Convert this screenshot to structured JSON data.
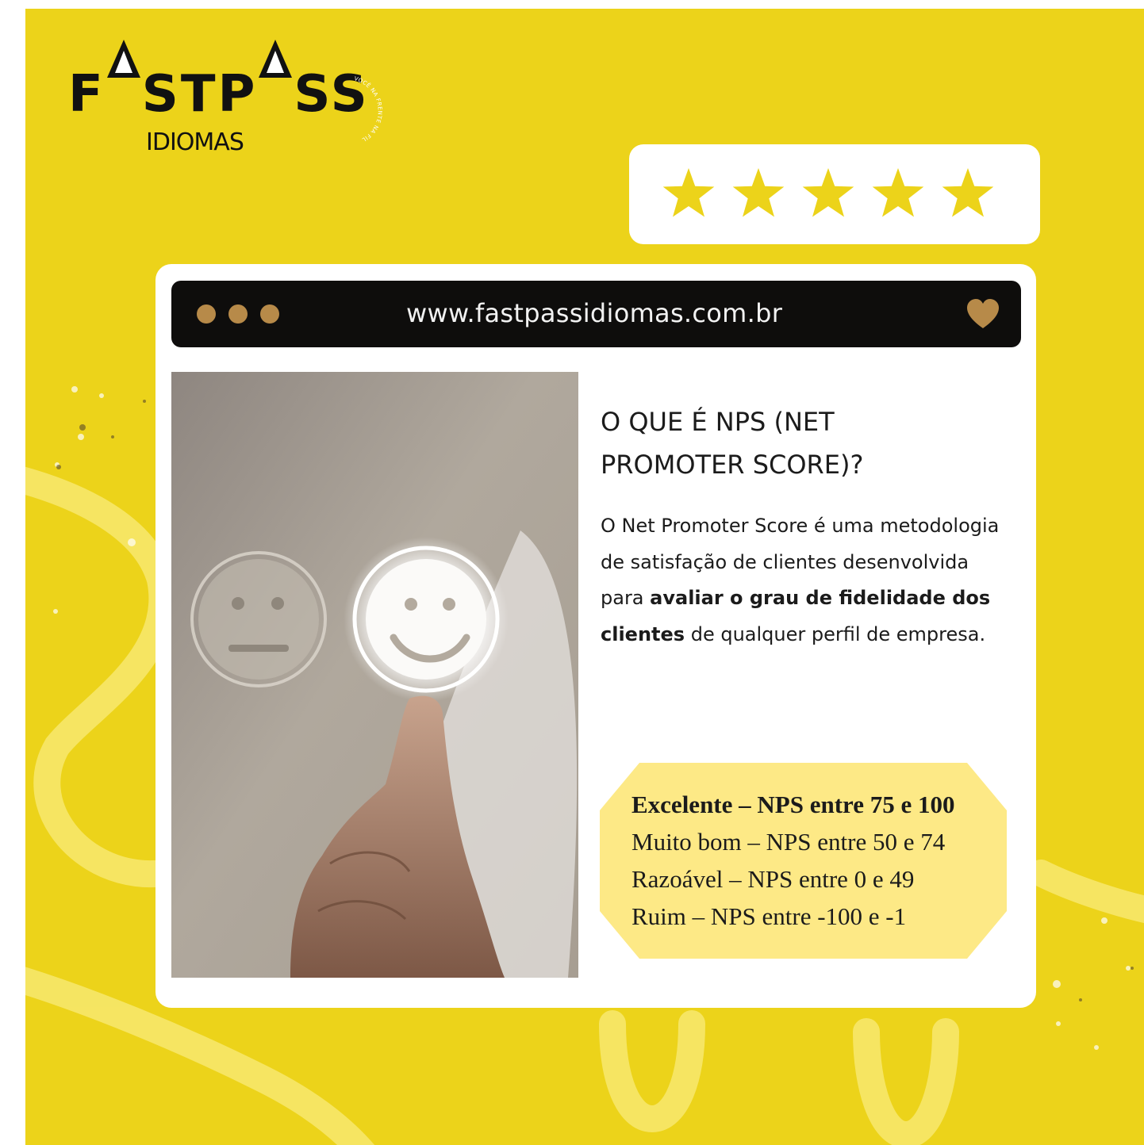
{
  "brand": {
    "name_part1": "F",
    "name_part2": "STP",
    "name_part3": "SS",
    "subtitle": "IDIOMAS",
    "seal_text": "VOCÊ NA FRENTE NA FILA PARA O SUCESSO"
  },
  "rating": {
    "stars": 5,
    "max": 5,
    "star_color": "#ecd31a"
  },
  "browser": {
    "url": "www.fastpassidiomas.com.br",
    "dot_color": "#b78a49"
  },
  "article": {
    "title_line1": "O QUE É NPS (NET",
    "title_line2": "PROMOTER SCORE)?",
    "body_intro": "O Net Promoter Score é uma metodologia de satisfação de clientes desenvolvida para ",
    "body_bold": "avaliar o grau de fidelidade dos clientes",
    "body_end": " de qualquer perfil de empresa."
  },
  "nps": {
    "lines": [
      "Excelente – NPS entre 75 e 100",
      "Muito bom – NPS entre 50 e 74",
      "Razoável – NPS entre 0 e 49",
      "Ruim – NPS entre -100 e -1"
    ]
  },
  "colors": {
    "background": "#ecd31a",
    "nps_box": "#fde986",
    "url_bar": "#0e0d0c"
  }
}
